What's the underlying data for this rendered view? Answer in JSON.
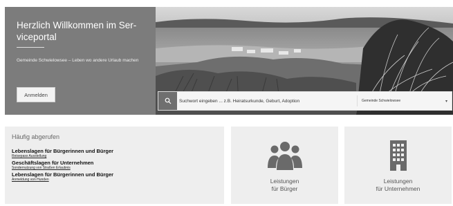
{
  "welcome": {
    "title": "Herzlich Willkommen im Ser-viceportal",
    "subtitle": "Gemeinde Schwielowsee – Leben wo andere Urlaub machen",
    "login_label": "Anmelden"
  },
  "search": {
    "placeholder": "Suchwort eingeben ... z.B. Heiratsurkunde, Geburt, Adoption",
    "municipality": "Gemeinde Schwielowsee",
    "icon": "search-icon"
  },
  "popular": {
    "title": "Häufig abgerufen",
    "items": [
      {
        "heading": "Lebenslagen für Bürgerinnen und Bürger",
        "link": "Reisepass Ausstellung"
      },
      {
        "heading": "Geschäftslagen für Unternehmen",
        "link": "Sondernutzung von Straßen Erlaubnis"
      },
      {
        "heading": "Lebenslagen für Bürgerinnen und Bürger",
        "link": "Anmeldung von Hunden"
      }
    ]
  },
  "tiles": {
    "buerger": {
      "line1": "Leistungen",
      "line2": "für Bürger",
      "icon": "users-icon"
    },
    "unternehmen": {
      "line1": "Leistungen",
      "line2": "für Unternehmen",
      "icon": "building-icon"
    }
  },
  "colors": {
    "welcome_bg": "#7c7c7c",
    "card_bg": "#eeeeee",
    "icon": "#6a6a6a"
  }
}
